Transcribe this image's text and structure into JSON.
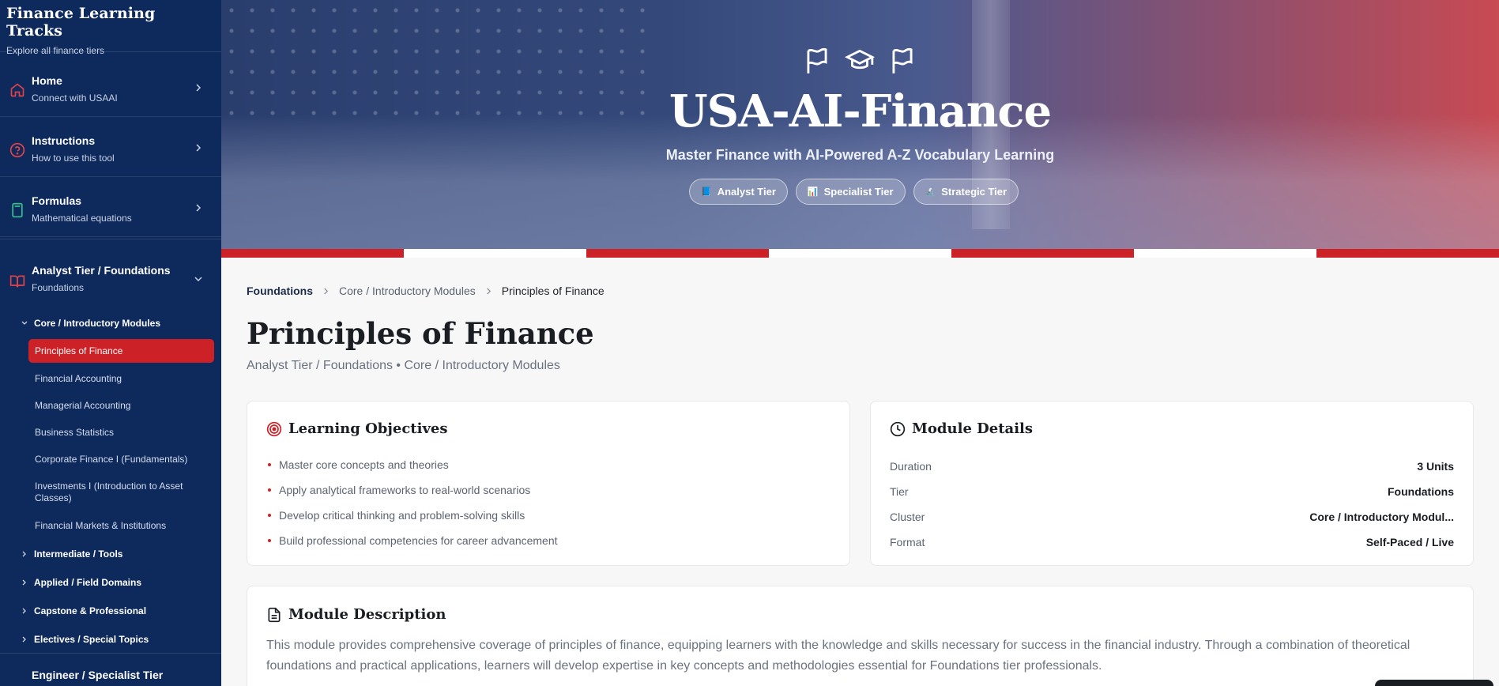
{
  "sidebar": {
    "title": "Finance Learning Tracks",
    "subtitle": "Explore all finance tiers",
    "nav": [
      {
        "label": "Home",
        "desc": "Connect with USAAI",
        "icon": "home-icon"
      },
      {
        "label": "Instructions",
        "desc": "How to use this tool",
        "icon": "help-circle-icon"
      },
      {
        "label": "Formulas",
        "desc": "Mathematical equations",
        "icon": "calculator-icon"
      },
      {
        "label": "Analyst Tier / Foundations",
        "desc": "Foundations",
        "icon": "book-icon"
      }
    ],
    "clusters": {
      "core": "Core / Introductory Modules",
      "intermediate": "Intermediate / Tools",
      "applied": "Applied / Field Domains",
      "capstone": "Capstone & Professional",
      "electives": "Electives / Special Topics"
    },
    "modules": [
      "Principles of Finance",
      "Financial Accounting",
      "Managerial Accounting",
      "Business Statistics",
      "Corporate Finance I (Fundamentals)",
      "Investments I (Introduction to Asset Classes)",
      "Financial Markets & Institutions"
    ],
    "next_tier": "Engineer / Specialist Tier"
  },
  "hero": {
    "title": "USA-AI-Finance",
    "subtitle": "Master Finance with AI-Powered A-Z Vocabulary Learning",
    "tiers": [
      {
        "label": "Analyst Tier",
        "icon": "📘"
      },
      {
        "label": "Specialist Tier",
        "icon": "📊"
      },
      {
        "label": "Strategic Tier",
        "icon": "🔬"
      }
    ]
  },
  "breadcrumb": {
    "first": "Foundations",
    "second": "Core / Introductory Modules",
    "current": "Principles of Finance"
  },
  "page": {
    "title": "Principles of Finance",
    "meta": "Analyst Tier / Foundations • Core / Introductory Modules"
  },
  "objectives": {
    "title": "Learning Objectives",
    "items": [
      "Master core concepts and theories",
      "Apply analytical frameworks to real-world scenarios",
      "Develop critical thinking and problem-solving skills",
      "Build professional competencies for career advancement"
    ]
  },
  "details": {
    "title": "Module Details",
    "rows": [
      {
        "key": "Duration",
        "value": "3 Units"
      },
      {
        "key": "Tier",
        "value": "Foundations"
      },
      {
        "key": "Cluster",
        "value": "Core / Introductory Modul..."
      },
      {
        "key": "Format",
        "value": "Self-Paced / Live"
      }
    ]
  },
  "description": {
    "title": "Module Description",
    "text": "This module provides comprehensive coverage of principles of finance, equipping learners with the knowledge and skills necessary for success in the financial industry. Through a combination of theoretical foundations and practical applications, learners will develop expertise in key concepts and methodologies essential for Foundations tier professionals."
  },
  "colors": {
    "sidebar": "#0e2a5c",
    "accent": "#cc2127"
  }
}
